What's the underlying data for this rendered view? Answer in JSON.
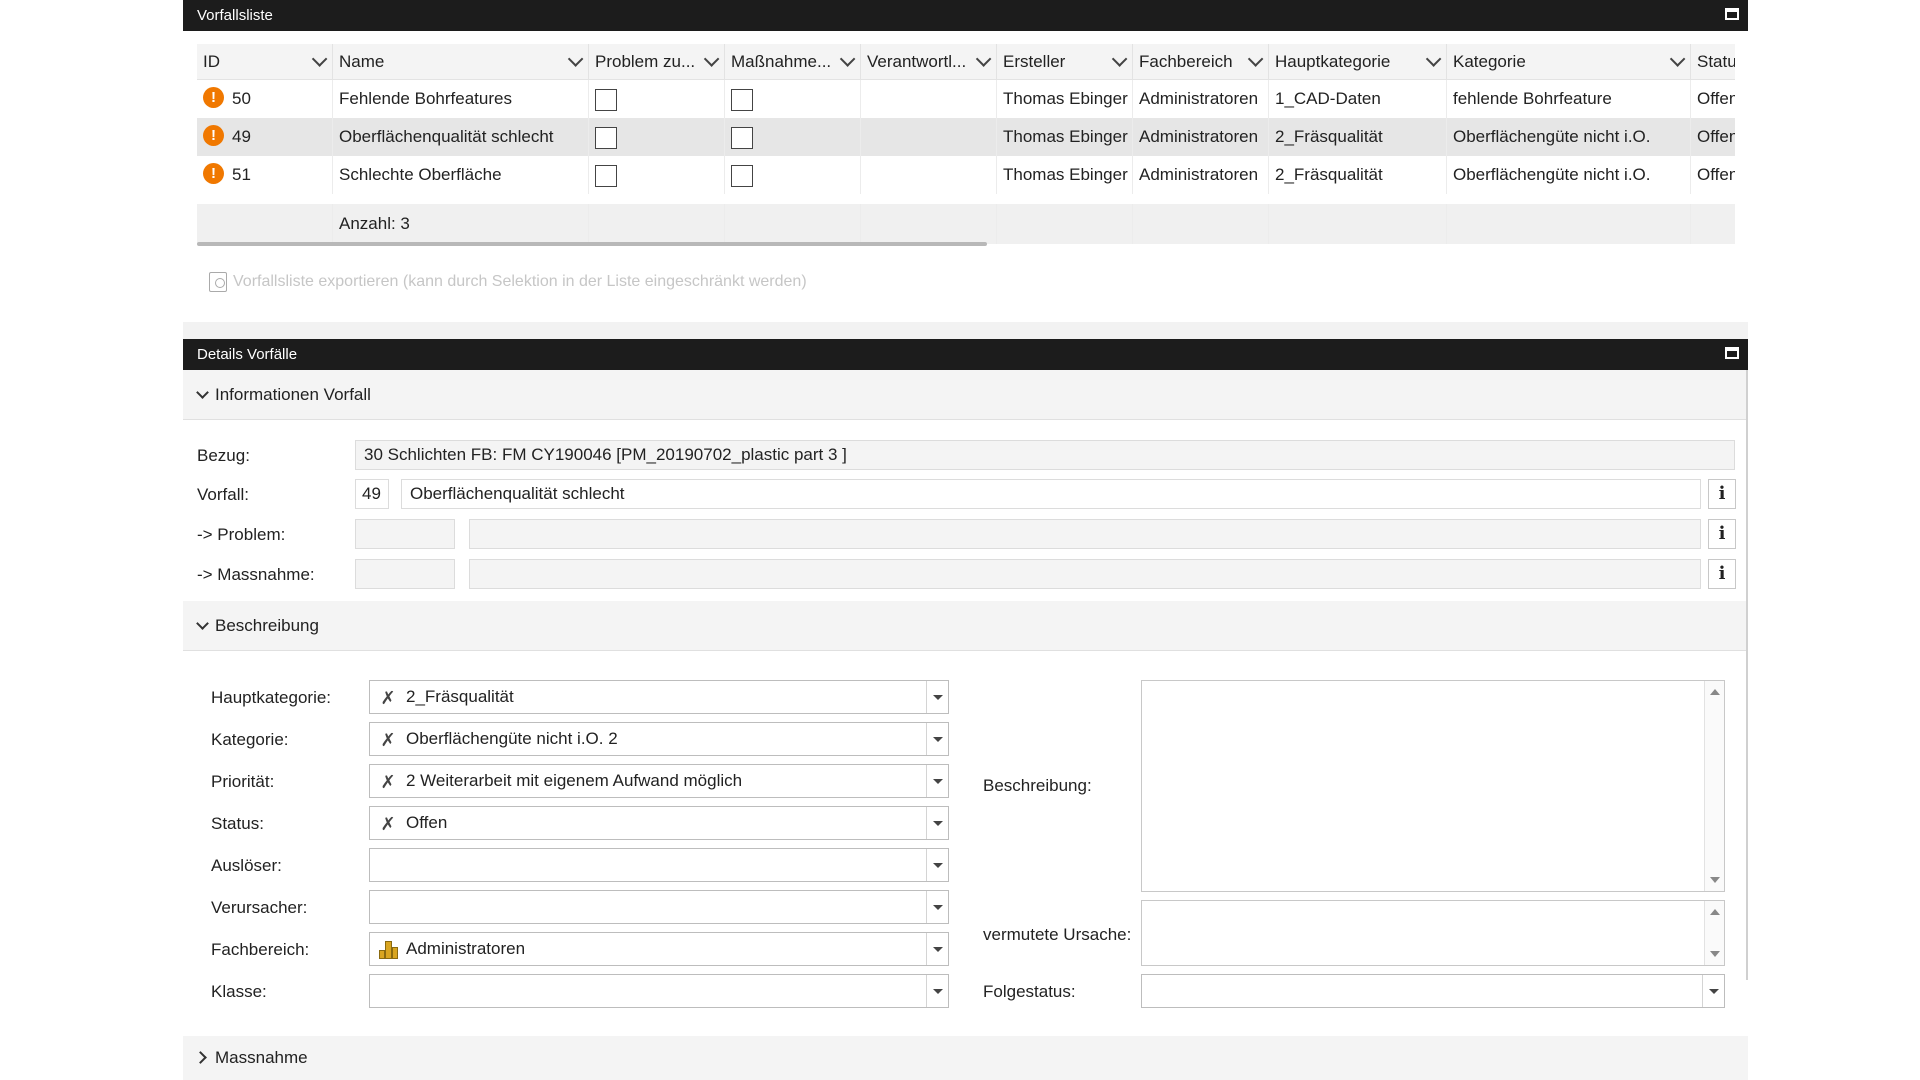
{
  "list_panel": {
    "title": "Vorfallsliste",
    "columns": [
      "ID",
      "Name",
      "Problem zu...",
      "Maßnahme...",
      "Verantwortl...",
      "Ersteller",
      "Fachbereich",
      "Hauptkategorie",
      "Kategorie",
      "Statu"
    ],
    "rows": [
      {
        "id": "50",
        "name": "Fehlende Bohrfeatures",
        "problem": false,
        "massnahme": false,
        "verantwortlich": "",
        "ersteller": "Thomas Ebinger",
        "fachbereich": "Administratoren",
        "hauptkategorie": "1_CAD-Daten",
        "kategorie": "fehlende Bohrfeature",
        "status": "Offen",
        "icon": "warning-icon",
        "selected": false
      },
      {
        "id": "49",
        "name": "Oberflächenqualität schlecht",
        "problem": false,
        "massnahme": false,
        "verantwortlich": "",
        "ersteller": "Thomas Ebinger",
        "fachbereich": "Administratoren",
        "hauptkategorie": "2_Fräsqualität",
        "kategorie": "Oberflächengüte nicht i.O.",
        "status": "Offen",
        "icon": "warning-icon",
        "selected": true
      },
      {
        "id": "51",
        "name": "Schlechte Oberfläche",
        "problem": false,
        "massnahme": false,
        "verantwortlich": "",
        "ersteller": "Thomas Ebinger",
        "fachbereich": "Administratoren",
        "hauptkategorie": "2_Fräsqualität",
        "kategorie": "Oberflächengüte nicht i.O.",
        "status": "Offen",
        "icon": "warning-icon",
        "selected": false
      }
    ],
    "summary": "Anzahl: 3",
    "export_label": "Vorfallsliste exportieren (kann durch Selektion in der Liste eingeschränkt werden)"
  },
  "details_panel": {
    "title": "Details Vorfälle",
    "info_section": {
      "title": "Informationen Vorfall",
      "bezug_label": "Bezug:",
      "bezug_value": "30 Schlichten FB: FM CY190046 [PM_20190702_plastic part 3 ]",
      "vorfall_label": "Vorfall:",
      "vorfall_id": "49",
      "vorfall_name": "Oberflächenqualität schlecht",
      "problem_label": "-> Problem:",
      "problem_id": "",
      "problem_name": "",
      "massnahme_label": "-> Massnahme:",
      "massnahme_id": "",
      "massnahme_name": "",
      "info_button": "i"
    },
    "beschreibung_section": {
      "title": "Beschreibung",
      "fields": [
        {
          "label": "Hauptkategorie:",
          "value": "2_Fräsqualität",
          "icon": "tools-icon"
        },
        {
          "label": "Kategorie:",
          "value": "Oberflächengüte nicht i.O. 2",
          "icon": "tools-icon"
        },
        {
          "label": "Priorität:",
          "value": "2 Weiterarbeit mit eigenem Aufwand möglich",
          "icon": "tools-icon"
        },
        {
          "label": "Status:",
          "value": "Offen",
          "icon": "tools-icon"
        },
        {
          "label": "Auslöser:",
          "value": "",
          "icon": ""
        },
        {
          "label": "Verursacher:",
          "value": "",
          "icon": ""
        },
        {
          "label": "Fachbereich:",
          "value": "Administratoren",
          "icon": "building-icon"
        },
        {
          "label": "Klasse:",
          "value": "",
          "icon": ""
        }
      ],
      "beschreibung_label": "Beschreibung:",
      "beschreibung_value": "",
      "ursache_label": "vermutete Ursache:",
      "ursache_value": "",
      "folgestatus_label": "Folgestatus:",
      "folgestatus_value": ""
    },
    "massnahme_section": {
      "title": "Massnahme"
    }
  },
  "colors": {
    "header_bg": "#1c1c1c",
    "warning": "#f07800",
    "selected_row": "#e6e6e6",
    "section_bg": "#f4f4f4"
  }
}
